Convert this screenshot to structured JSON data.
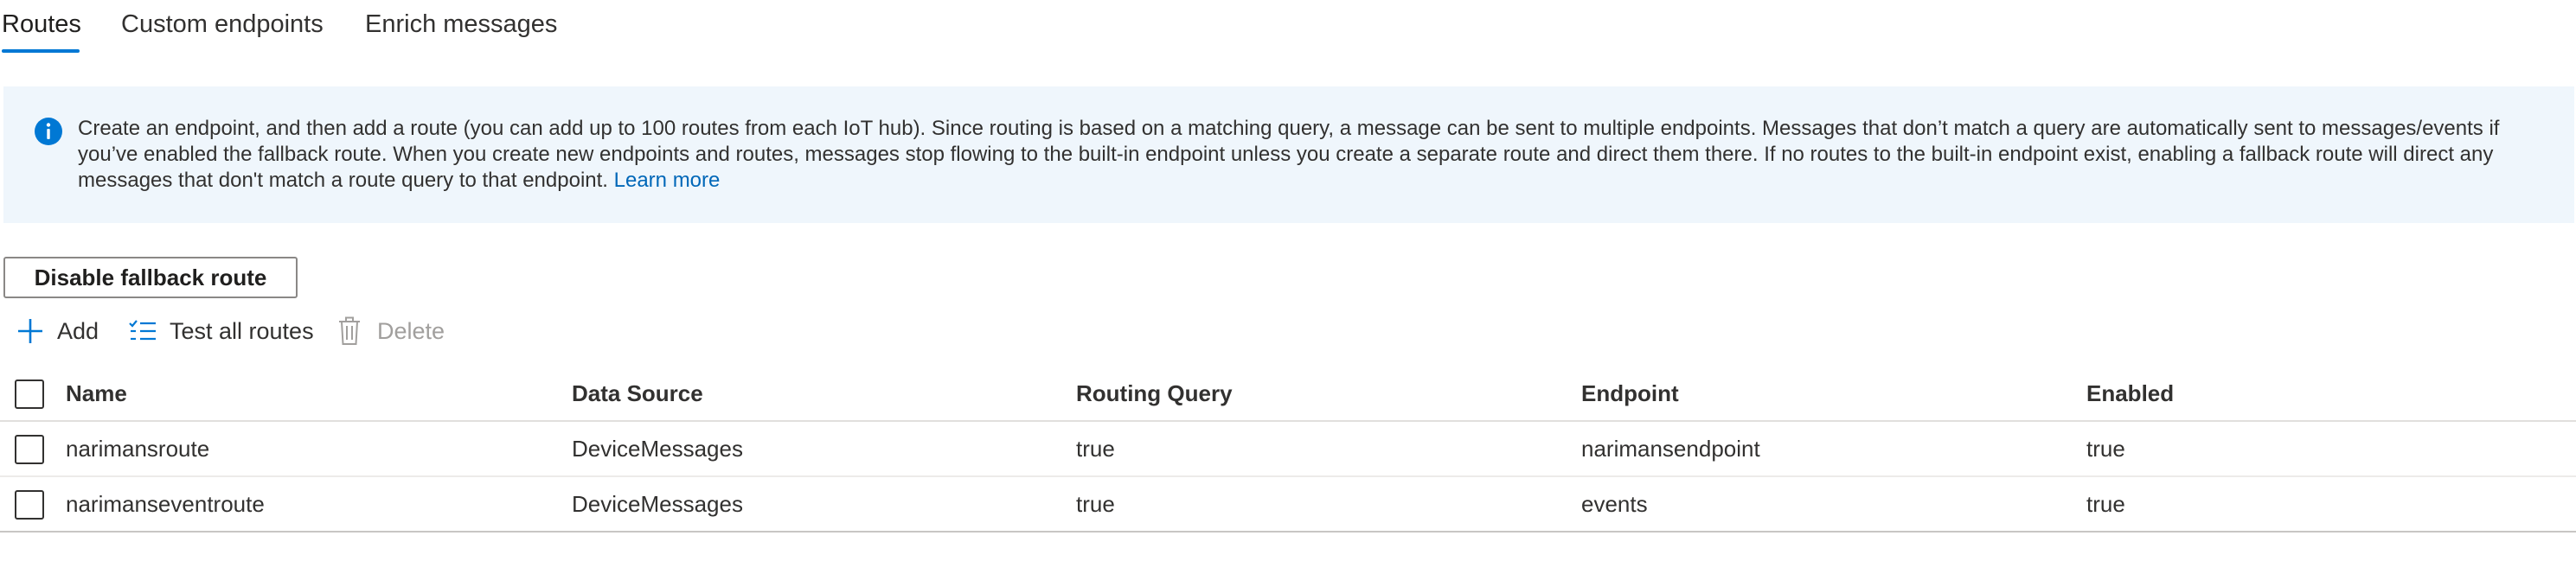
{
  "tabs": [
    {
      "label": "Routes",
      "active": true
    },
    {
      "label": "Custom endpoints",
      "active": false
    },
    {
      "label": "Enrich messages",
      "active": false
    }
  ],
  "banner": {
    "icon": "info-icon",
    "text_line1": "Create an endpoint, and then add a route (you can add up to 100 routes from each IoT hub). Since routing is based on a matching query, a message can be sent to multiple endpoints. Messages that don’t match a query are automatically sent to messages/events if",
    "text_line2": "you’ve enabled the fallback route. When you create new endpoints and routes, messages stop flowing to the built-in endpoint unless you create a separate route and direct them there. If no routes to the built-in endpoint exist, enabling a fallback route will direct any",
    "text_line3": "messages that don't match a route query to that endpoint.",
    "link": "Learn more"
  },
  "fallback_button": "Disable fallback route",
  "toolbar": {
    "add": "Add",
    "test_all": "Test all routes",
    "delete": "Delete"
  },
  "table": {
    "columns": [
      "Name",
      "Data Source",
      "Routing Query",
      "Endpoint",
      "Enabled"
    ],
    "rows": [
      {
        "name": "narimansroute",
        "source": "DeviceMessages",
        "query": "true",
        "endpoint": "narimansendpoint",
        "enabled": "true"
      },
      {
        "name": "narimanseventroute",
        "source": "DeviceMessages",
        "query": "true",
        "endpoint": "events",
        "enabled": "true"
      }
    ]
  },
  "colors": {
    "accent": "#0078d4",
    "info_bg": "#eff6fc",
    "link": "#0067b8"
  }
}
